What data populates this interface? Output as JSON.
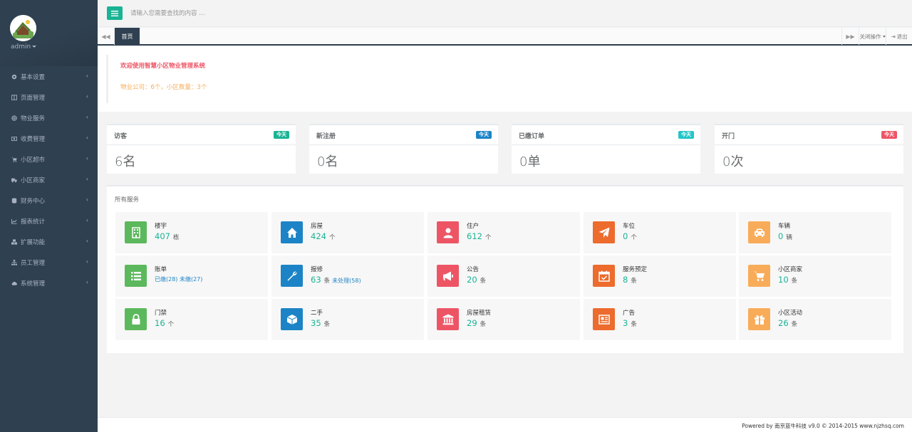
{
  "sidebar": {
    "admin_name": "admin",
    "items": [
      {
        "label": "基本设置",
        "icon": "gear-icon"
      },
      {
        "label": "页面管理",
        "icon": "columns-icon"
      },
      {
        "label": "物业服务",
        "icon": "globe-icon"
      },
      {
        "label": "收费管理",
        "icon": "money-icon"
      },
      {
        "label": "小区超市",
        "icon": "cart-icon"
      },
      {
        "label": "小区商家",
        "icon": "truck-icon"
      },
      {
        "label": "财务中心",
        "icon": "database-icon"
      },
      {
        "label": "报表统计",
        "icon": "line-chart-icon"
      },
      {
        "label": "扩展功能",
        "icon": "cubes-icon"
      },
      {
        "label": "员工管理",
        "icon": "sitemap-icon"
      },
      {
        "label": "系统管理",
        "icon": "cloud-icon"
      }
    ]
  },
  "topbar": {
    "search_placeholder": "请输入您需要查找的内容 …"
  },
  "tabs": {
    "home": "首页",
    "close_ops": "关闭操作",
    "logout": "退出"
  },
  "welcome": {
    "title": "欢迎使用智慧小区物业管理系统",
    "stats": "物业公司：6个，小区数量：3个"
  },
  "cards": [
    {
      "title": "访客",
      "badge": "今天",
      "badge_color": "#1ab394",
      "value": "6名"
    },
    {
      "title": "新注册",
      "badge": "今天",
      "badge_color": "#1c84c6",
      "value": "0名"
    },
    {
      "title": "已缴订单",
      "badge": "今天",
      "badge_color": "#23c6c8",
      "value": "0单"
    },
    {
      "title": "开门",
      "badge": "今天",
      "badge_color": "#ed5565",
      "value": "0次"
    }
  ],
  "services": {
    "title": "所有服务",
    "items": [
      {
        "name": "楼宇",
        "value": "407",
        "unit": "栋",
        "icon": "building-icon",
        "color": "#5cb85c"
      },
      {
        "name": "房屋",
        "value": "424",
        "unit": "个",
        "icon": "home-icon",
        "color": "#1c84c6"
      },
      {
        "name": "住户",
        "value": "612",
        "unit": "个",
        "icon": "user-icon",
        "color": "#ed5565"
      },
      {
        "name": "车位",
        "value": "0",
        "unit": "个",
        "icon": "paper-plane-icon",
        "color": "#ec6b2d"
      },
      {
        "name": "车辆",
        "value": "0",
        "unit": "辆",
        "icon": "car-icon",
        "color": "#f8ac59"
      },
      {
        "name": "账单",
        "value": "",
        "unit": "",
        "extra": "已缴(28) 未缴(27)",
        "icon": "list-icon",
        "color": "#5cb85c"
      },
      {
        "name": "报修",
        "value": "63",
        "unit": "条",
        "extra": "未处理(58)",
        "icon": "wrench-icon",
        "color": "#1c84c6"
      },
      {
        "name": "公告",
        "value": "20",
        "unit": "条",
        "icon": "bullhorn-icon",
        "color": "#ed5565"
      },
      {
        "name": "服务预定",
        "value": "8",
        "unit": "条",
        "icon": "calendar-check-icon",
        "color": "#ec6b2d"
      },
      {
        "name": "小区商家",
        "value": "10",
        "unit": "条",
        "icon": "shopping-cart-icon",
        "color": "#f8ac59"
      },
      {
        "name": "门禁",
        "value": "16",
        "unit": "个",
        "icon": "lock-icon",
        "color": "#5cb85c"
      },
      {
        "name": "二手",
        "value": "35",
        "unit": "条",
        "icon": "cube-icon",
        "color": "#1c84c6"
      },
      {
        "name": "房屋租赁",
        "value": "29",
        "unit": "条",
        "icon": "bank-icon",
        "color": "#ed5565"
      },
      {
        "name": "广告",
        "value": "3",
        "unit": "条",
        "icon": "newspaper-icon",
        "color": "#ec6b2d"
      },
      {
        "name": "小区活动",
        "value": "26",
        "unit": "条",
        "icon": "gift-icon",
        "color": "#f8ac59"
      }
    ]
  },
  "footer": {
    "text": "Powered by 南京蓝牛科技 v9.0 © 2014-2015 www.njzhsq.com"
  }
}
